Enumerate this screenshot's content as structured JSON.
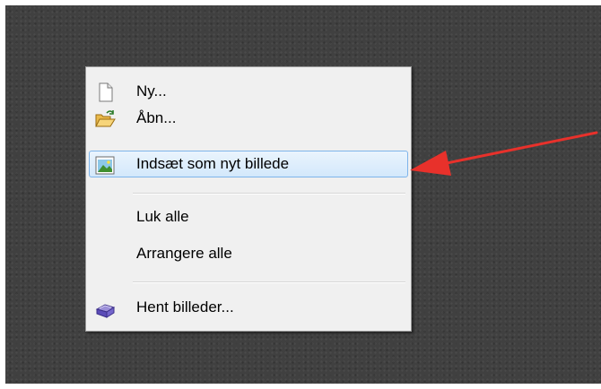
{
  "menu": {
    "items": [
      {
        "label": "Ny...",
        "icon": "new-document-icon"
      },
      {
        "label": "Åbn...",
        "icon": "open-folder-icon"
      },
      {
        "label": "Indsæt som nyt billede",
        "icon": "paste-image-icon"
      },
      {
        "label": "Luk alle",
        "icon": ""
      },
      {
        "label": "Arrangere alle",
        "icon": ""
      },
      {
        "label": "Hent billeder...",
        "icon": "scanner-icon"
      }
    ],
    "highlighted_index": 2
  },
  "colors": {
    "workspace_bg": "#404040",
    "menu_bg": "#f0f0f0",
    "highlight_border": "#7eb4ea",
    "annotation_arrow": "#e8312b"
  }
}
